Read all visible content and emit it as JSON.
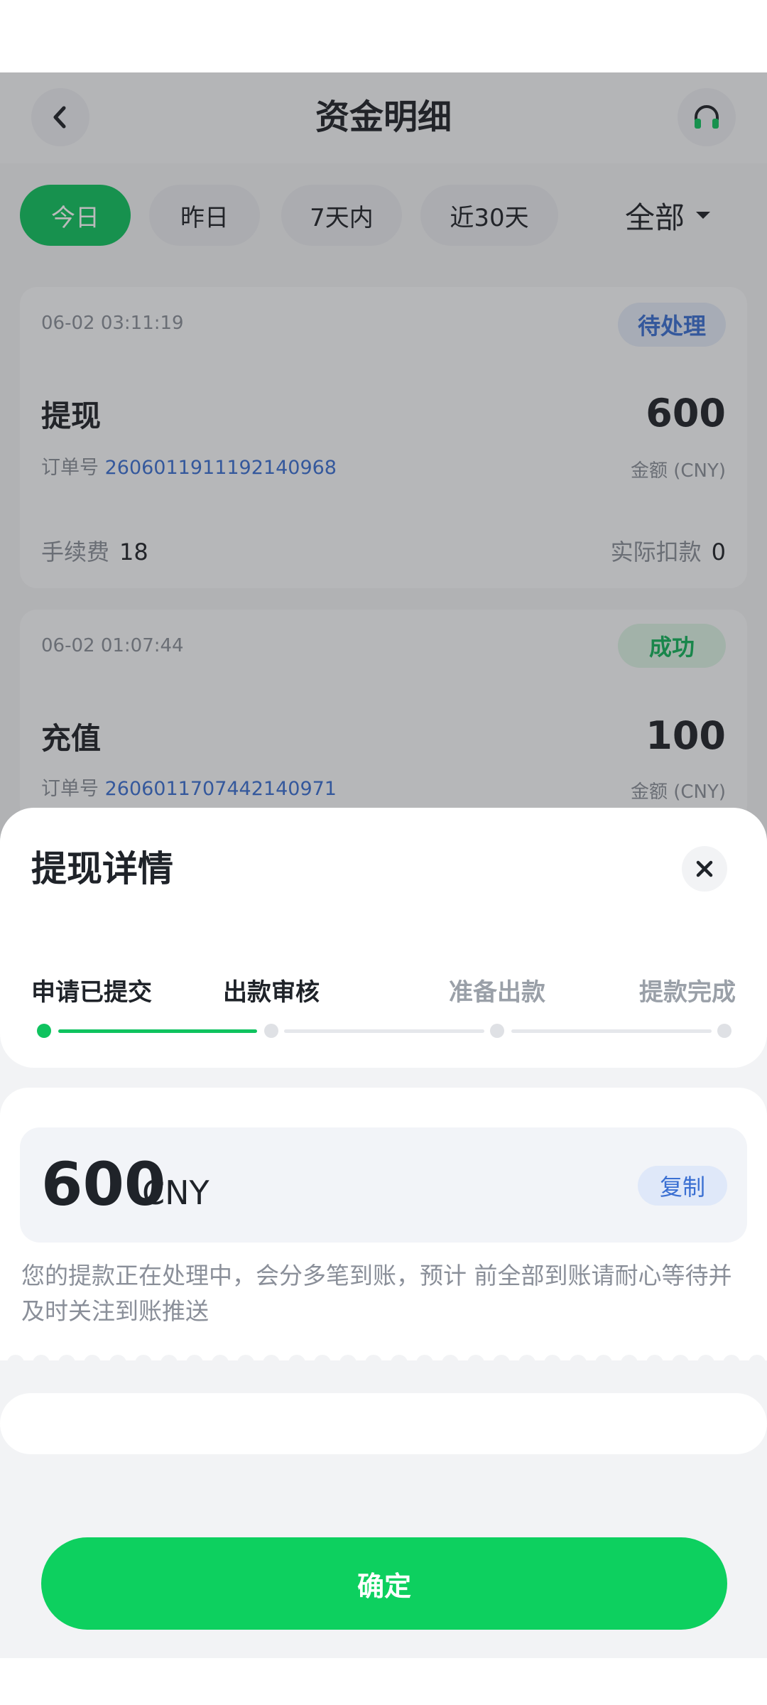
{
  "page": {
    "title": "资金明细",
    "filters": [
      "今日",
      "昨日",
      "7天内",
      "近30天"
    ],
    "filter_all": "全部",
    "colors": {
      "accent": "#0fc35f",
      "link": "#3a6fd2"
    }
  },
  "records": [
    {
      "time": "06-02 03:11:19",
      "status": "待处理",
      "type": "提现",
      "amount": "600",
      "order_label": "订单号",
      "order_no": "2606011911192140968",
      "currency_label": "金额 (CNY)",
      "fee_label": "手续费",
      "fee": "18",
      "deduct_label": "实际扣款",
      "deduct": "0"
    },
    {
      "time": "06-02 01:07:44",
      "status": "成功",
      "type": "充值",
      "amount": "100",
      "order_label": "订单号",
      "order_no": "2606011707442140971",
      "currency_label": "金额 (CNY)"
    }
  ],
  "sheet": {
    "title": "提现详情",
    "steps": [
      "申请已提交",
      "出款审核",
      "准备出款",
      "提款完成"
    ],
    "current_step": 2,
    "amount": "600",
    "unit": "CNY",
    "copy_label": "复制",
    "notice": "您的提款正在处理中，会分多笔到账，预计 前全部到账请耐心等待并及时关注到账推送",
    "confirm_label": "确定"
  }
}
